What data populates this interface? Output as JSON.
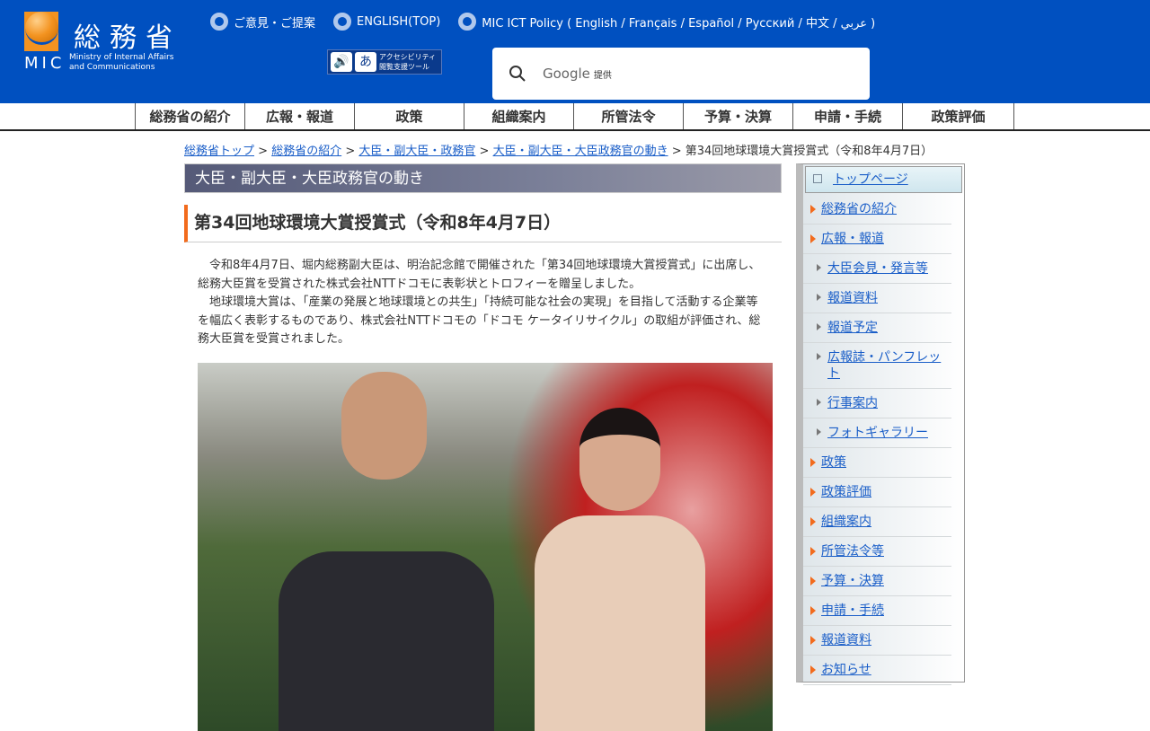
{
  "header": {
    "logo_ja": "総務省",
    "logo_abbr": "MIC",
    "logo_en": [
      "Ministry of Internal Affairs",
      "and Communications"
    ],
    "top_links": [
      "ご意見・ご提案",
      "ENGLISH(TOP)",
      "MIC ICT Policy ( English / Français / Español / Русский / 中文 / عربي )"
    ],
    "a11y_label": [
      "アクセシビリティ",
      "閲覧支援ツール"
    ],
    "search_brand": "Google",
    "search_provided": "提供"
  },
  "nav": [
    "総務省の紹介",
    "広報・報道",
    "政策",
    "組織案内",
    "所管法令",
    "予算・決算",
    "申請・手続",
    "政策評価"
  ],
  "breadcrumb": {
    "links": [
      "総務省トップ",
      "総務省の紹介",
      "大臣・副大臣・政務官",
      "大臣・副大臣・大臣政務官の動き"
    ],
    "current": "第34回地球環境大賞授賞式（令和8年4月7日）"
  },
  "main": {
    "section_title": "大臣・副大臣・大臣政務官の動き",
    "title": "第34回地球環境大賞授賞式（令和8年4月7日）",
    "paragraphs": [
      "令和8年4月7日、堀内総務副大臣は、明治記念館で開催された「第34回地球環境大賞授賞式」に出席し、総務大臣賞を受賞された株式会社NTTドコモに表彰状とトロフィーを贈呈しました。",
      "地球環境大賞は、「産業の発展と地球環境との共生」「持続可能な社会の実現」を目指して活動する企業等を幅広く表彰するものであり、株式会社NTTドコモの「ドコモ ケータイリサイクル」の取組が評価され、総務大臣賞を受賞されました。"
    ]
  },
  "side": {
    "top": "トップページ",
    "items": [
      {
        "label": "総務省の紹介",
        "sub": false
      },
      {
        "label": "広報・報道",
        "sub": false
      },
      {
        "label": "大臣会見・発言等",
        "sub": true
      },
      {
        "label": "報道資料",
        "sub": true
      },
      {
        "label": "報道予定",
        "sub": true
      },
      {
        "label": "広報誌・パンフレット",
        "sub": true
      },
      {
        "label": "行事案内",
        "sub": true
      },
      {
        "label": "フォトギャラリー",
        "sub": true
      },
      {
        "label": "政策",
        "sub": false
      },
      {
        "label": "政策評価",
        "sub": false
      },
      {
        "label": "組織案内",
        "sub": false
      },
      {
        "label": "所管法令等",
        "sub": false
      },
      {
        "label": "予算・決算",
        "sub": false
      },
      {
        "label": "申請・手続",
        "sub": false
      },
      {
        "label": "報道資料",
        "sub": false
      },
      {
        "label": "お知らせ",
        "sub": false
      }
    ]
  }
}
